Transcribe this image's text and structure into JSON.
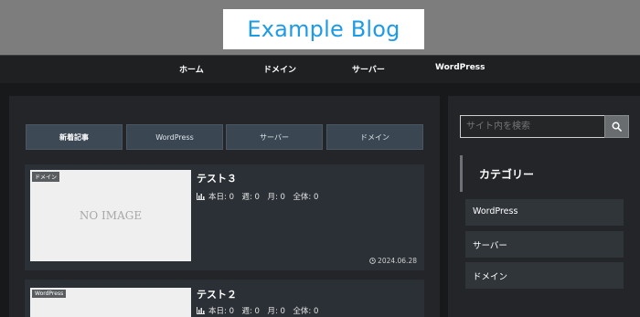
{
  "header": {
    "logo": "Example Blog"
  },
  "nav": {
    "items": [
      "ホーム",
      "ドメイン",
      "サーバー",
      "WordPress"
    ]
  },
  "main": {
    "tabs": [
      "新着記事",
      "WordPress",
      "サーバー",
      "ドメイン"
    ],
    "posts": [
      {
        "category": "ドメイン",
        "thumbnail_text": "NO IMAGE",
        "title": "テスト３",
        "stats": "本日: 0　週: 0　月: 0　全体: 0",
        "date": "2024.06.28"
      },
      {
        "category": "WordPress",
        "thumbnail_text": "",
        "title": "テスト２",
        "stats": "本日: 0　週: 0　月: 0　全体: 0",
        "date": ""
      }
    ]
  },
  "sidebar": {
    "search_placeholder": "サイト内を検索",
    "category_heading": "カテゴリー",
    "categories": [
      "WordPress",
      "サーバー",
      "ドメイン"
    ]
  },
  "colors": {
    "logo_text": "#1e9ae6",
    "header_band": "#7d7d7d",
    "tab_background": "#3a4753",
    "card_background": "#2b3036"
  }
}
